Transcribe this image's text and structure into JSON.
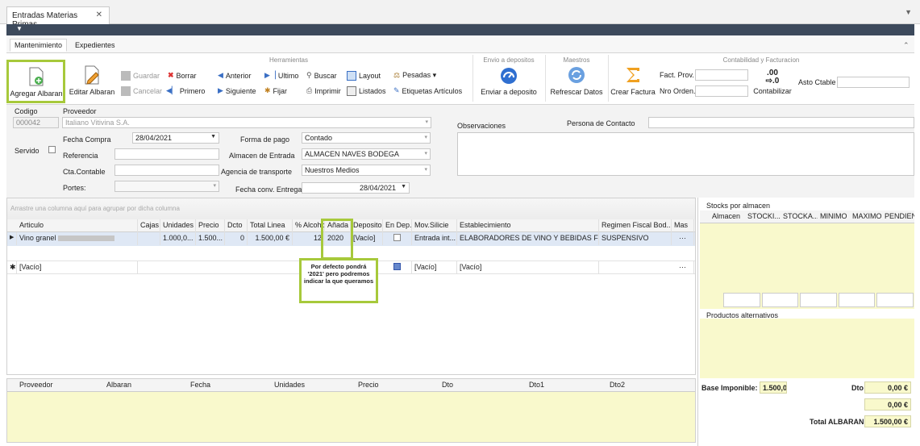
{
  "window": {
    "doc_tab": "Entradas Materias Primas",
    "close_glyph": "✕",
    "strip_arrow": "▼",
    "subbar_arrow": "▼"
  },
  "ribbon_tabs": [
    "Mantenimiento",
    "Expedientes"
  ],
  "ribbon_collapse_glyph": "⌃",
  "groups": {
    "herramientas": "Herramientas",
    "envio": "Envio a depositos",
    "maestros": "Maestros",
    "contabilidad": "Contabilidad y Facturacion"
  },
  "buttons": {
    "agregar": "Agregar Albaran",
    "editar": "Editar Albaran",
    "guardar": "Guardar",
    "cancelar": "Cancelar",
    "borrar": "Borrar",
    "primero": "Primero",
    "anterior": "Anterior",
    "siguiente": "Siguiente",
    "ultimo": "Ultimo",
    "fijar": "Fijar",
    "buscar": "Buscar",
    "imprimir": "Imprimir",
    "layout": "Layout",
    "listados": "Listados",
    "pesadas": "Pesadas ▾",
    "etiquetas": "Etiquetas Artículos",
    "enviar": "Enviar a deposito",
    "refrescar": "Refrescar Datos",
    "crear_factura": "Crear Factura",
    "contabilizar": "Contabilizar",
    "contabilizar_glyph": ".00\n⇨.0"
  },
  "contab": {
    "fact_prov_label": "Fact. Prov.",
    "nro_orden_label": "Nro Orden.",
    "asto_label": "Asto Ctable"
  },
  "form": {
    "codigo_label": "Codigo",
    "codigo_value": "000042",
    "proveedor_label": "Proveedor",
    "proveedor_value": "Italiano Vitivina S.A.",
    "fecha_compra_label": "Fecha Compra",
    "fecha_compra_value": "28/04/2021",
    "forma_pago_label": "Forma de pago",
    "forma_pago_value": "Contado",
    "observaciones_label": "Observaciones",
    "persona_label": "Persona de Contacto",
    "servido_label": "Servido",
    "referencia_label": "Referencia",
    "almacen_label": "Almacen de Entrada",
    "almacen_value": "ALMACEN NAVES BODEGA",
    "cta_label": "Cta.Contable",
    "agencia_label": "Agencia de transporte",
    "agencia_value": "Nuestros Medios",
    "portes_label": "Portes:",
    "fecha_conv_label": "Fecha conv. Entrega",
    "fecha_conv_value": "28/04/2021"
  },
  "grid": {
    "group_hint": "Arrastre una columna aquí para agrupar por dicha columna",
    "columns": [
      "Articulo",
      "Cajas",
      "Unidades",
      "Precio",
      "Dcto",
      "Total Linea",
      "% Alcohol",
      "Añada",
      "Deposito",
      "En Dep.",
      "Mov.Silicie",
      "Establecimiento",
      "Regimen Fiscal Bod...",
      "Mas"
    ],
    "row1": {
      "articulo": "Vino granel",
      "unidades": "1.000,0...",
      "precio": "1.500...",
      "dcto": "0",
      "total": "1.500,00 €",
      "alcohol": "12",
      "anada": "2020",
      "deposito": "[Vacío]",
      "mov": "Entrada int...",
      "establecimiento": "ELABORADORES DE VINO Y BEBIDAS FER...",
      "regimen": "SUSPENSIVO",
      "mas": "···"
    },
    "row2": {
      "marker": "✱",
      "articulo": "[Vacío]",
      "mov": "[Vacío]",
      "establecimiento": "[Vacío]",
      "mas": "···"
    },
    "callout": "Por defecto pondrá '2021' pero podremos indicar la que queramos"
  },
  "stocks": {
    "title": "Stocks por almacen",
    "columns": [
      "Almacen",
      "STOCKI...",
      "STOCKA...",
      "MINIMO",
      "MAXIMO",
      "PENDIEN..."
    ]
  },
  "alternativos": {
    "title": "Productos alternativos"
  },
  "bottom_grid": {
    "columns": [
      "Proveedor",
      "Albaran",
      "Fecha",
      "Unidades",
      "Precio",
      "Dto",
      "Dto1",
      "Dto2"
    ]
  },
  "totals": {
    "base_label": "Base Imponible:",
    "base_value": "1.500,00 €",
    "dto_label": "Dto",
    "dto_value": "0,00 €",
    "extra_value": "0,00 €",
    "total_label": "Total ALBARAN ...:",
    "total_value": "1.500,00 €"
  },
  "colors": {
    "highlight": "#a7c93b",
    "selected_row": "#dfe8f5",
    "yellow_panel": "#f9f9cc"
  }
}
